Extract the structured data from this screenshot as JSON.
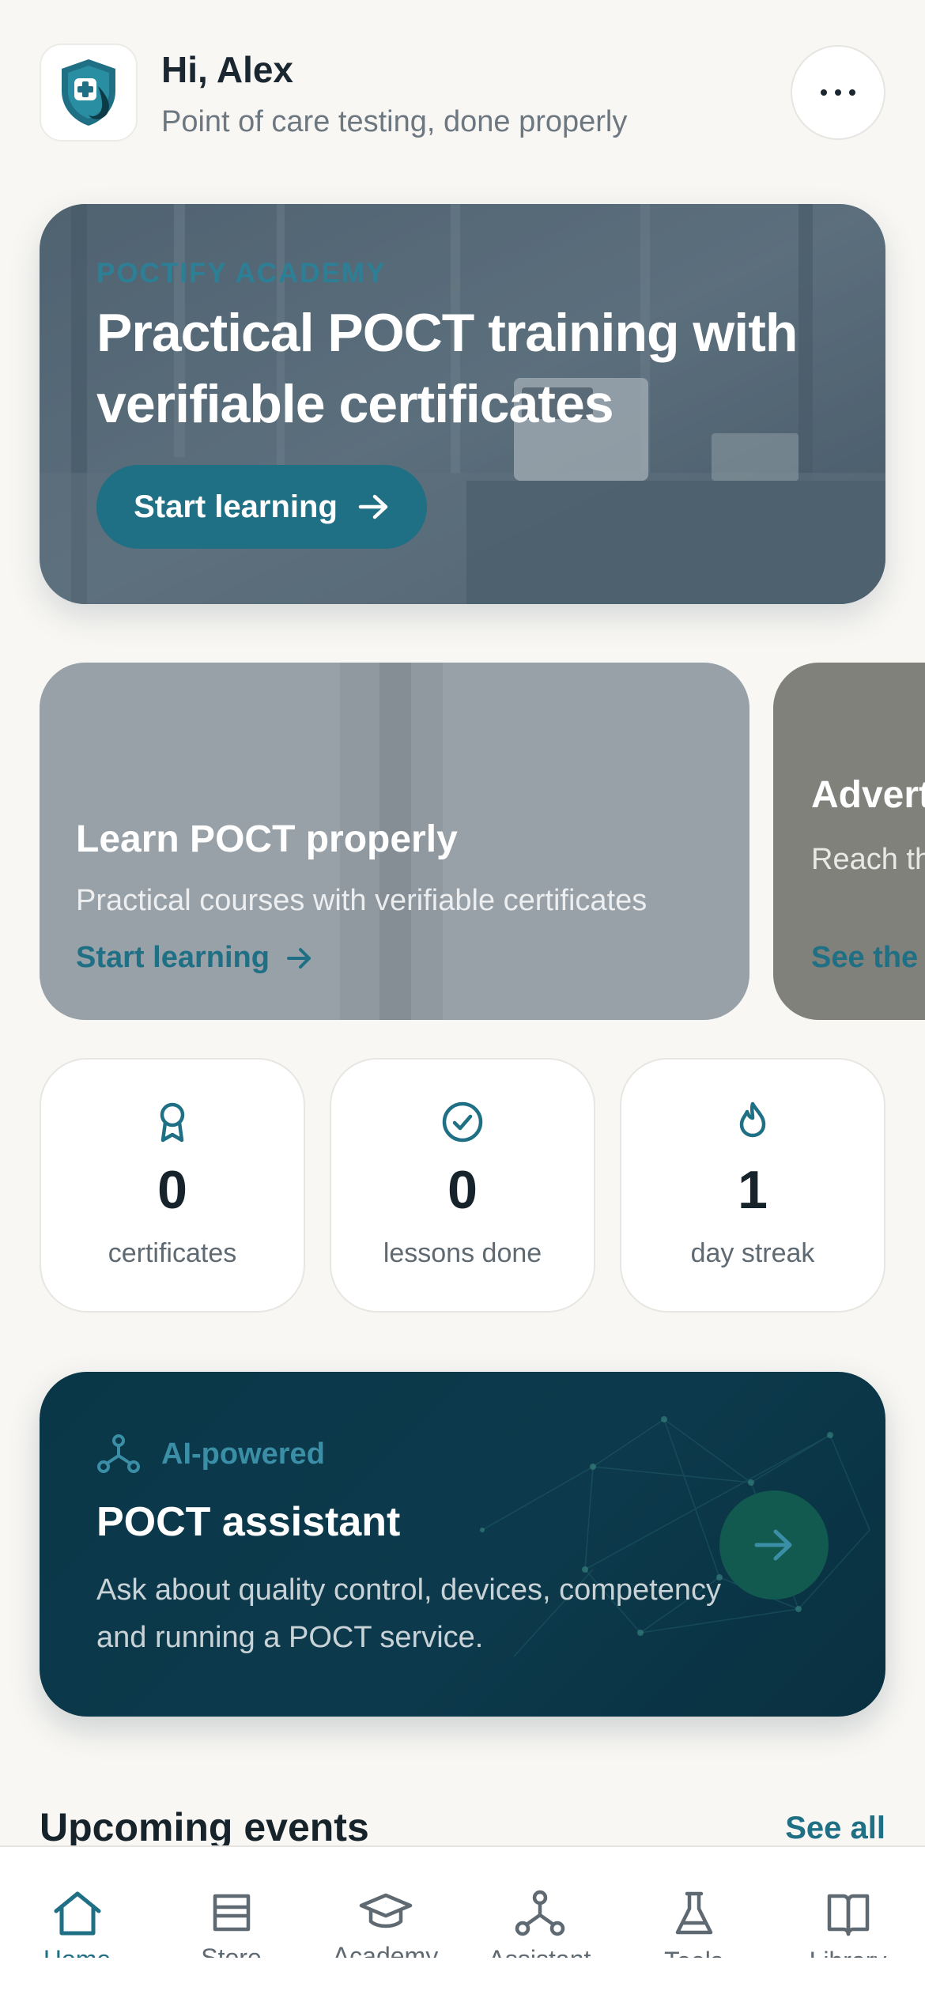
{
  "header": {
    "greeting": "Hi, Alex",
    "tagline": "Point of care testing, done properly",
    "logo_icon": "shield-cross-drop-icon",
    "more_icon": "more-dots-icon"
  },
  "hero": {
    "eyebrow": "POCTIFY ACADEMY",
    "title": "Practical POCT training with verifiable certificates",
    "button_label": "Start learning",
    "button_icon": "arrow-right-icon"
  },
  "promos": [
    {
      "title": "Learn POCT properly",
      "subtitle": "Practical courses with verifiable certificates",
      "link_label": "Start learning"
    },
    {
      "title": "Advert",
      "subtitle": "Reach th of care t",
      "link_label": "See the"
    }
  ],
  "stats": [
    {
      "value": "0",
      "label": "certificates",
      "icon": "award-ribbon-icon"
    },
    {
      "value": "0",
      "label": "lessons done",
      "icon": "check-circle-icon"
    },
    {
      "value": "1",
      "label": "day streak",
      "icon": "flame-icon"
    }
  ],
  "assistant": {
    "badge": "AI-powered",
    "title": "POCT assistant",
    "description": "Ask about quality control, devices, competency and running a POCT service.",
    "icon": "network-nodes-icon"
  },
  "events": {
    "title": "Upcoming events",
    "see_all": "See all"
  },
  "tabbar": {
    "active": "Home",
    "tabs": [
      {
        "label": "Home",
        "icon": "home-icon"
      },
      {
        "label": "Store",
        "icon": "store-icon"
      },
      {
        "label": "Academy",
        "icon": "graduation-cap-icon"
      },
      {
        "label": "Assistant",
        "icon": "network-nodes-icon"
      },
      {
        "label": "Tools",
        "icon": "flask-icon"
      },
      {
        "label": "Library",
        "icon": "book-icon"
      }
    ]
  },
  "colors": {
    "accent": "#1f6f85",
    "background": "#f8f7f4",
    "assistant_bg": "#0a3748",
    "text": "#17232b",
    "muted": "#6d7780"
  }
}
